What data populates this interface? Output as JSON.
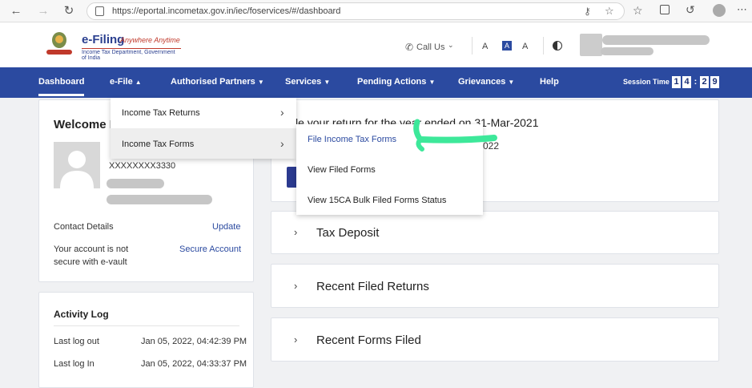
{
  "browser": {
    "url": "https://eportal.incometax.gov.in/iec/foservices/#/dashboard"
  },
  "header": {
    "brand_title": "e-Filing",
    "brand_tagline": "Anywhere Anytime",
    "brand_subtitle": "Income Tax Department, Government of India",
    "call_us": "Call Us",
    "font_decrease": "A",
    "font_normal": "A",
    "font_increase": "A"
  },
  "nav": {
    "items": [
      "Dashboard",
      "e-File",
      "Authorised Partners",
      "Services",
      "Pending Actions",
      "Grievances",
      "Help"
    ],
    "session_label": "Session Time",
    "session_digits": [
      "1",
      "4",
      ":",
      "2",
      "9"
    ]
  },
  "welcome": {
    "title": "Welcome B",
    "pan": "XXXXXXXX3330",
    "contact_label": "Contact Details",
    "update_link": "Update",
    "secure_text_1": "Your account is not",
    "secure_text_2": "secure with e-vault",
    "secure_link": "Secure Account"
  },
  "activity": {
    "title": "Activity Log",
    "rows": [
      {
        "label": "Last log out",
        "value": "Jan 05, 2022, 04:42:39 PM"
      },
      {
        "label": "Last log In",
        "value": "Jan 05, 2022, 04:33:37 PM"
      }
    ]
  },
  "filing_card": {
    "line1": "le your return for the year ended on 31-Mar-2021",
    "line2": "022"
  },
  "accordions": [
    "Tax Deposit",
    "Recent Filed Returns",
    "Recent Forms Filed"
  ],
  "efile_menu": {
    "items": [
      "Income Tax Returns",
      "Income Tax Forms"
    ]
  },
  "forms_submenu": {
    "items": [
      "File Income Tax Forms",
      "View Filed Forms",
      "View 15CA Bulk Filed Forms Status"
    ]
  },
  "colors": {
    "nav_bg": "#2b4aa0",
    "link": "#2b4aa0",
    "annotation_arrow": "#3de89a"
  }
}
